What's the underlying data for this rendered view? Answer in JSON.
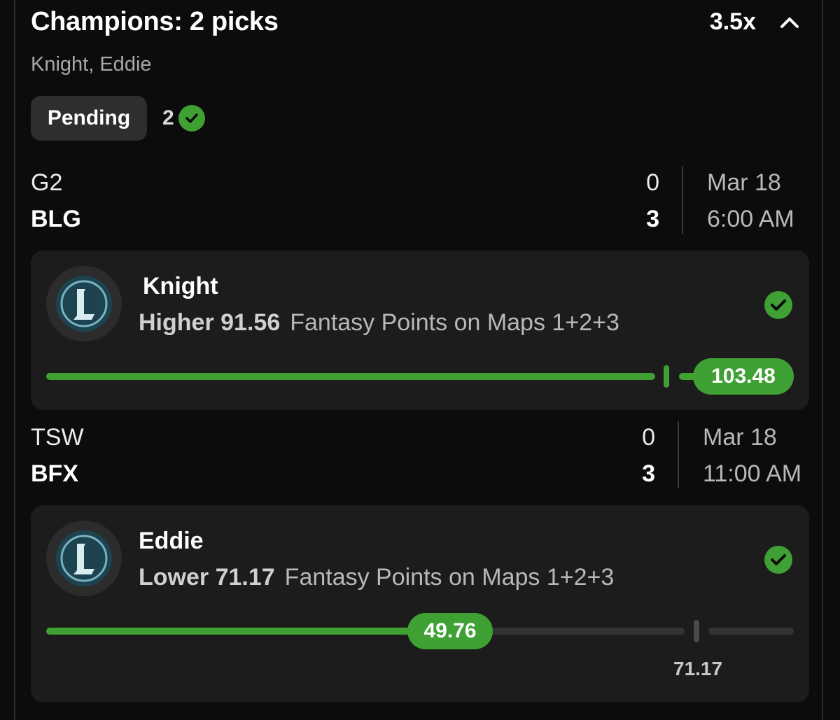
{
  "header": {
    "title": "Champions: 2 picks",
    "multiplier": "3.5x",
    "players": "Knight, Eddie",
    "status": "Pending",
    "hits": "2"
  },
  "matches": [
    {
      "team1": "G2",
      "score1": "0",
      "team2": "BLG",
      "score2": "3",
      "date": "Mar 18",
      "time": "6:00 AM"
    },
    {
      "team1": "TSW",
      "score1": "0",
      "team2": "BFX",
      "score2": "3",
      "date": "Mar 18",
      "time": "11:00 AM"
    }
  ],
  "picks": [
    {
      "player": "Knight",
      "direction": "Higher",
      "line": "91.56",
      "stat": "Fantasy Points on Maps 1+2+3",
      "result": "103.48",
      "result_value": 103.48,
      "line_value": 91.56
    },
    {
      "player": "Eddie",
      "direction": "Lower",
      "line": "71.17",
      "stat": "Fantasy Points on Maps 1+2+3",
      "result": "49.76",
      "result_value": 49.76,
      "line_value": 71.17,
      "line_label": "71.17"
    }
  ],
  "icons": {
    "collapse": "chevron-up-icon",
    "check": "check-circle-icon",
    "avatar": "league-of-legends-logo"
  },
  "colors": {
    "accent_green": "#3fa033",
    "background": "#0c0c0c",
    "card": "#1c1c1c"
  }
}
